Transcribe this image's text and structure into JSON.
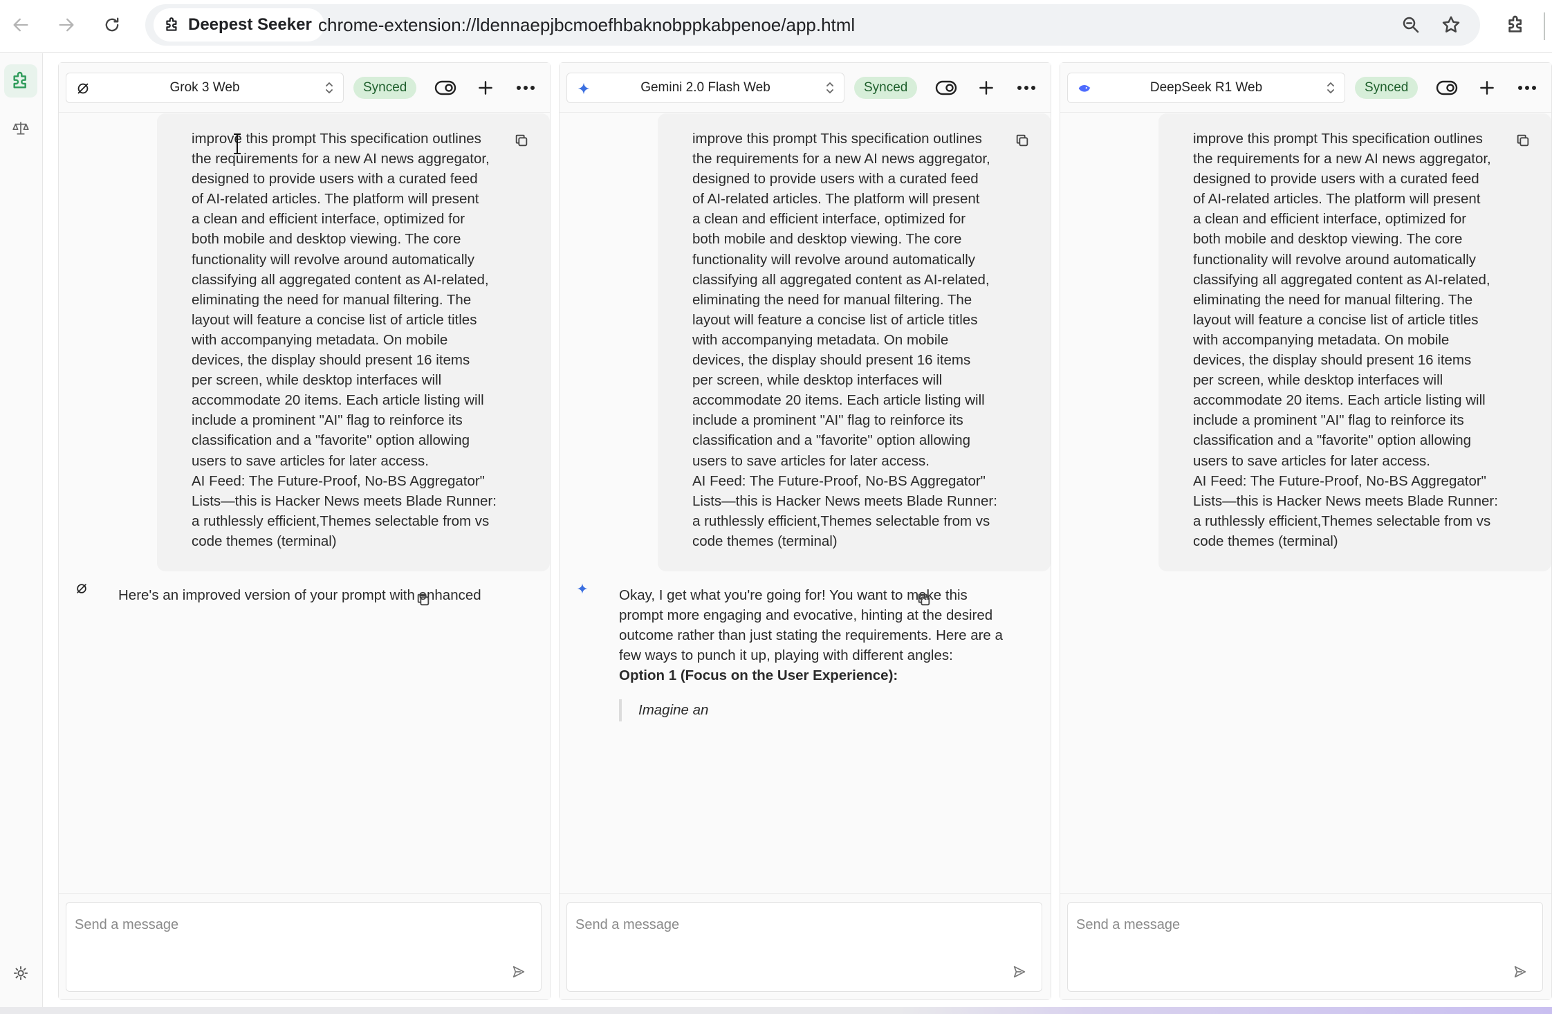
{
  "browser": {
    "site_name": "Deepest Seeker",
    "url": "chrome-extension://ldennaepjbcmoefhbaknobppkabpenoe/app.html"
  },
  "sidebar": {
    "items": [
      {
        "icon": "puzzle-icon",
        "active": true
      },
      {
        "icon": "scale-icon",
        "active": false
      }
    ],
    "footer_icon": "sun-icon"
  },
  "columns": [
    {
      "model": "Grok 3 Web",
      "model_icon": "grok-logo-icon",
      "status": "Synced",
      "user_message": "improve this prompt This specification outlines\nthe requirements for a new AI news aggregator,\ndesigned to provide users with a curated feed\nof AI-related articles. The platform will present\na clean and efficient interface, optimized for\nboth mobile and desktop viewing. The core\nfunctionality will revolve around automatically\nclassifying all aggregated content as AI-related,\neliminating the need for manual filtering. The\nlayout will feature a concise list of article titles\nwith accompanying metadata. On mobile\ndevices, the display should present 16 items\nper screen, while desktop interfaces will\naccommodate 20 items. Each article listing will\ninclude a prominent \"AI\" flag to reinforce its\nclassification and a \"favorite\" option allowing\nusers to save articles for later access.\nAI Feed: The Future-Proof, No-BS Aggregator\"\nLists—this is Hacker News meets Blade Runner:\na ruthlessly efficient,Themes selectable from vs\ncode themes (terminal)",
      "bot_message": "Here's an improved version of your prompt with enhanced",
      "composer_placeholder": "Send a message"
    },
    {
      "model": "Gemini 2.0 Flash Web",
      "model_icon": "gemini-sparkle-icon",
      "status": "Synced",
      "user_message": "improve this prompt This specification outlines\nthe requirements for a new AI news aggregator,\ndesigned to provide users with a curated feed\nof AI-related articles. The platform will present\na clean and efficient interface, optimized for\nboth mobile and desktop viewing. The core\nfunctionality will revolve around automatically\nclassifying all aggregated content as AI-related,\neliminating the need for manual filtering. The\nlayout will feature a concise list of article titles\nwith accompanying metadata. On mobile\ndevices, the display should present 16 items\nper screen, while desktop interfaces will\naccommodate 20 items. Each article listing will\ninclude a prominent \"AI\" flag to reinforce its\nclassification and a \"favorite\" option allowing\nusers to save articles for later access.\nAI Feed: The Future-Proof, No-BS Aggregator\"\nLists—this is Hacker News meets Blade Runner:\na ruthlessly efficient,Themes selectable from vs\ncode themes (terminal)",
      "bot_message": "Okay, I get what you're going for! You want to make this prompt more engaging and evocative, hinting at the desired outcome rather than just stating the requirements. Here are a few ways to punch it up, playing with different angles:",
      "bot_option": "Option 1 (Focus on the User Experience):",
      "bot_quote": "Imagine an",
      "composer_placeholder": "Send a message"
    },
    {
      "model": "DeepSeek R1 Web",
      "model_icon": "deepseek-whale-icon",
      "status": "Synced",
      "user_message": "improve this prompt This specification outlines\nthe requirements for a new AI news aggregator,\ndesigned to provide users with a curated feed\nof AI-related articles. The platform will present\na clean and efficient interface, optimized for\nboth mobile and desktop viewing. The core\nfunctionality will revolve around automatically\nclassifying all aggregated content as AI-related,\neliminating the need for manual filtering. The\nlayout will feature a concise list of article titles\nwith accompanying metadata. On mobile\ndevices, the display should present 16 items\nper screen, while desktop interfaces will\naccommodate 20 items. Each article listing will\ninclude a prominent \"AI\" flag to reinforce its\nclassification and a \"favorite\" option allowing\nusers to save articles for later access.\nAI Feed: The Future-Proof, No-BS Aggregator\"\nLists—this is Hacker News meets Blade Runner:\na ruthlessly efficient,Themes selectable from vs\ncode themes (terminal)",
      "composer_placeholder": "Send a message"
    }
  ],
  "colors": {
    "synced_bg": "#d7eed9",
    "synced_text": "#1e5f2c",
    "accent_green": "#2e9b5a",
    "gemini_blue": "#3b6fe0",
    "deepseek_blue": "#4d6bfe"
  }
}
